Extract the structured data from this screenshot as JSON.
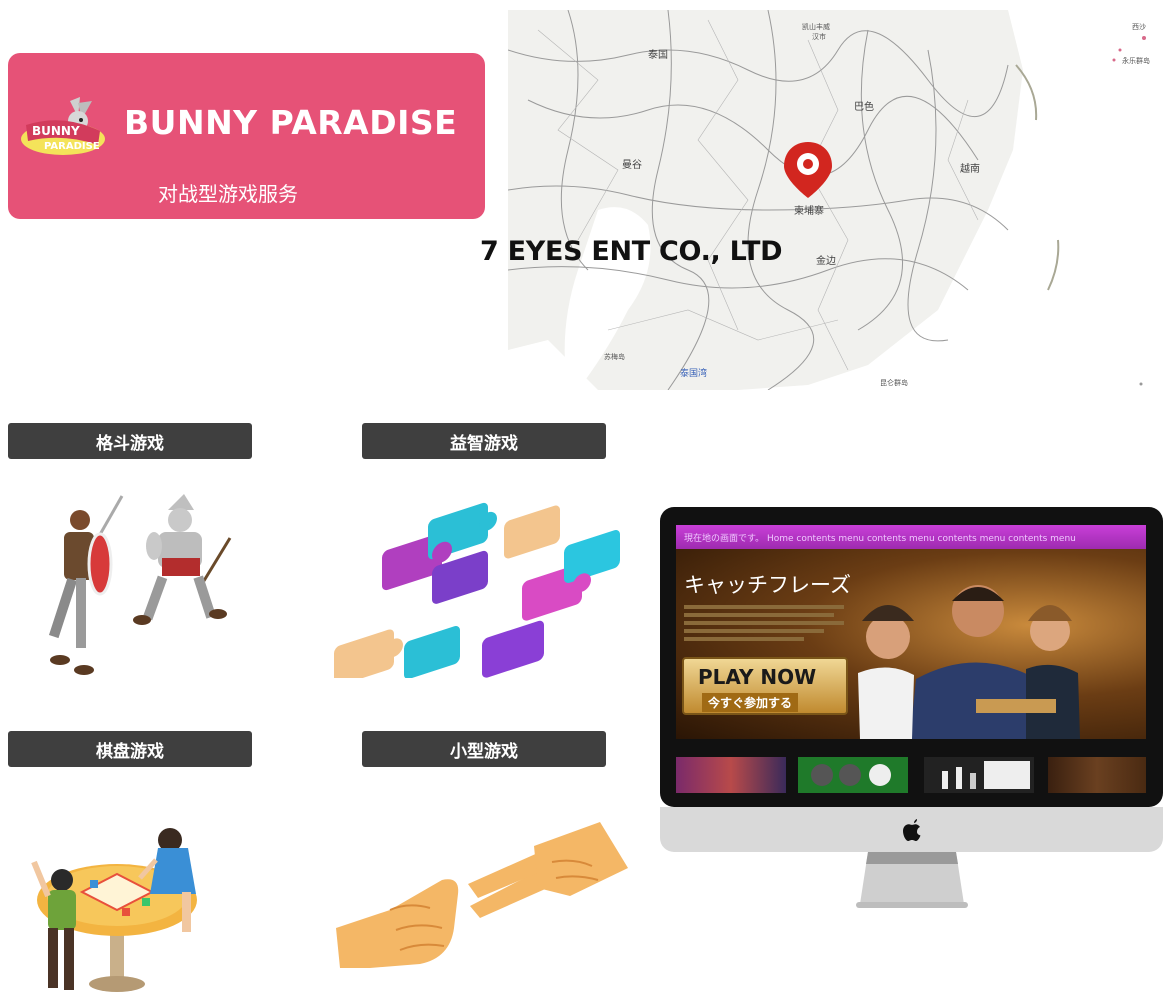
{
  "brand": {
    "title": "BUNNY PARADISE",
    "subtitle": "对战型游戏服务",
    "logo_text": "BUNNY PARADISE",
    "color": "#e65277"
  },
  "map": {
    "labels": {
      "thailand": "泰国",
      "bangkok": "曼谷",
      "pakse": "巴色",
      "vietnam": "越南",
      "cambodia": "柬埔寨",
      "phnom_penh": "金边",
      "gulf": "泰国湾",
      "surat": "苏梅岛",
      "kaishan_line1": "凯山丰威",
      "kaishan_line2": "汉市",
      "islands": "昆仑群岛",
      "xisha": "西沙",
      "paracel": "永乐群岛"
    },
    "pin_color": "#d2261f"
  },
  "company": "7 EYES ENT CO., LTD",
  "categories": [
    {
      "label": "格斗游戏",
      "icon": "fighting-warriors-icon"
    },
    {
      "label": "益智游戏",
      "icon": "puzzle-pieces-icon"
    },
    {
      "label": "棋盘游戏",
      "icon": "board-game-icon"
    },
    {
      "label": "小型游戏",
      "icon": "rock-paper-scissors-icon"
    }
  ],
  "monitor": {
    "nav_text": "現在地の画面です。 Home contents menu contents menu contents menu contents menu",
    "catchphrase": "キャッチフレーズ",
    "play_now": "PLAY NOW",
    "play_now_sub": "今すぐ参加する",
    "brand_icon": "apple-logo-icon"
  }
}
